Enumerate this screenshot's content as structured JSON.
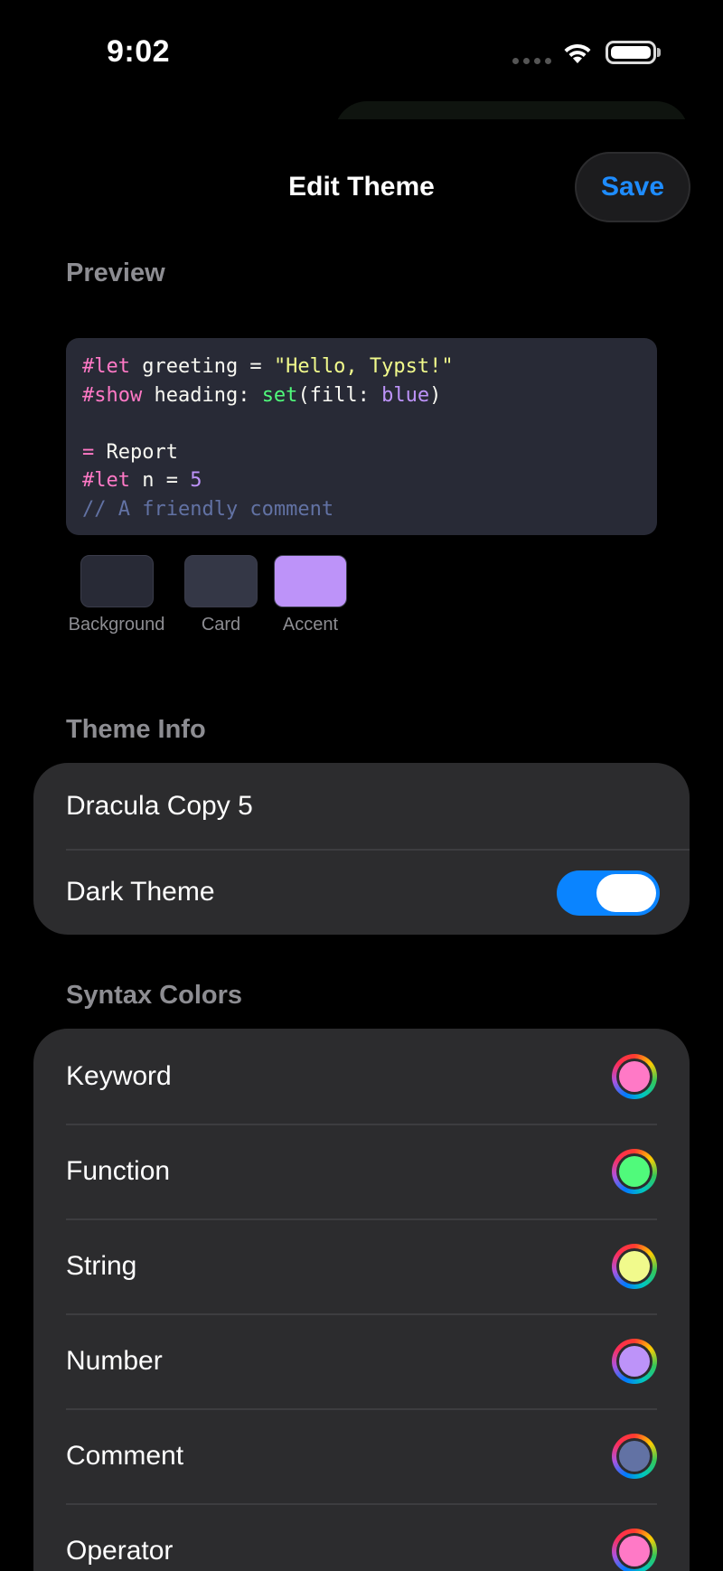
{
  "status_bar": {
    "time": "9:02"
  },
  "header": {
    "title": "Edit Theme",
    "save_label": "Save"
  },
  "preview": {
    "section_title": "Preview",
    "code_lines": [
      [
        {
          "t": "#let",
          "c": "kw"
        },
        {
          "t": " greeting = ",
          "c": "tx"
        },
        {
          "t": "\"Hello, Typst!\"",
          "c": "str"
        }
      ],
      [
        {
          "t": "#show",
          "c": "kw"
        },
        {
          "t": " heading: ",
          "c": "tx"
        },
        {
          "t": "set",
          "c": "fn"
        },
        {
          "t": "(fill: ",
          "c": "tx"
        },
        {
          "t": "blue",
          "c": "num"
        },
        {
          "t": ")",
          "c": "tx"
        }
      ],
      [],
      [
        {
          "t": "=",
          "c": "kw"
        },
        {
          "t": " Report",
          "c": "tx"
        }
      ],
      [
        {
          "t": "#let",
          "c": "kw"
        },
        {
          "t": " n = ",
          "c": "tx"
        },
        {
          "t": "5",
          "c": "num"
        }
      ],
      [
        {
          "t": "// A friendly comment",
          "c": "cm"
        }
      ]
    ],
    "swatches": [
      {
        "label": "Background",
        "color": "#282a36"
      },
      {
        "label": "Card",
        "color": "#343746"
      },
      {
        "label": "Accent",
        "color": "#bd93f9"
      }
    ]
  },
  "theme_info": {
    "section_title": "Theme Info",
    "name_value": "Dracula Copy 5",
    "dark_label": "Dark Theme",
    "dark_enabled": true
  },
  "syntax_colors": {
    "section_title": "Syntax Colors",
    "items": [
      {
        "label": "Keyword",
        "color": "#ff79c6"
      },
      {
        "label": "Function",
        "color": "#50fa7b"
      },
      {
        "label": "String",
        "color": "#f1fa8c"
      },
      {
        "label": "Number",
        "color": "#bd93f9"
      },
      {
        "label": "Comment",
        "color": "#6272a4"
      },
      {
        "label": "Operator",
        "color": "#ff79c6"
      }
    ]
  },
  "colors": {
    "accent": "#0a84ff",
    "save_text": "#1e8cff",
    "group_bg": "#2c2c2e"
  }
}
